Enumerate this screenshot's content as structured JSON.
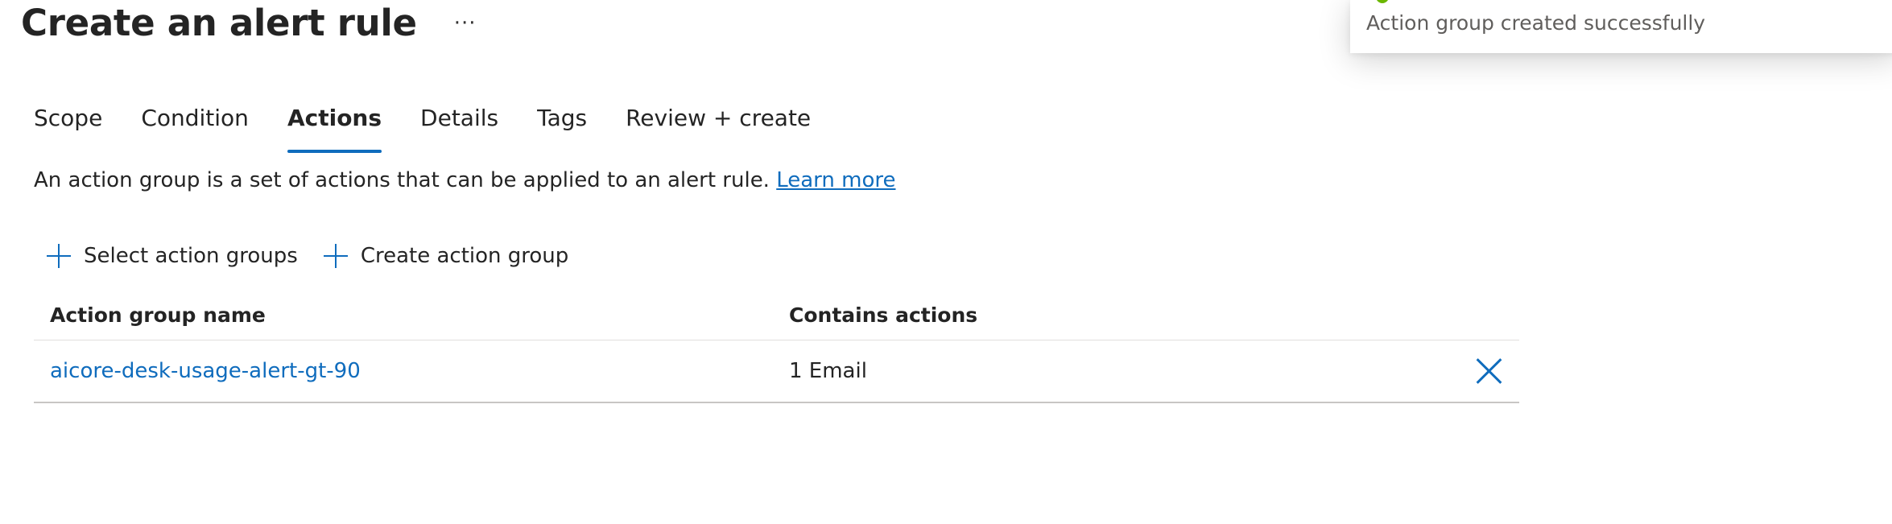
{
  "page": {
    "title": "Create an alert rule",
    "more_label": "···"
  },
  "tabs": [
    {
      "label": "Scope"
    },
    {
      "label": "Condition"
    },
    {
      "label": "Actions"
    },
    {
      "label": "Details"
    },
    {
      "label": "Tags"
    },
    {
      "label": "Review + create"
    }
  ],
  "active_tab": "Actions",
  "description": {
    "text": "An action group is a set of actions that can be applied to an alert rule. ",
    "link": "Learn more"
  },
  "toolbar": {
    "select_label": "Select action groups",
    "create_label": "Create action group"
  },
  "table": {
    "headers": [
      "Action group name",
      "Contains actions"
    ],
    "rows": [
      {
        "name": "aicore-desk-usage-alert-gt-90",
        "actions": "1 Email"
      }
    ]
  },
  "toast": {
    "message": "Action group created successfully",
    "status_color": "#6bb700"
  },
  "colors": {
    "accent": "#0f6cbd",
    "text": "#242424",
    "muted": "#605e5c"
  }
}
